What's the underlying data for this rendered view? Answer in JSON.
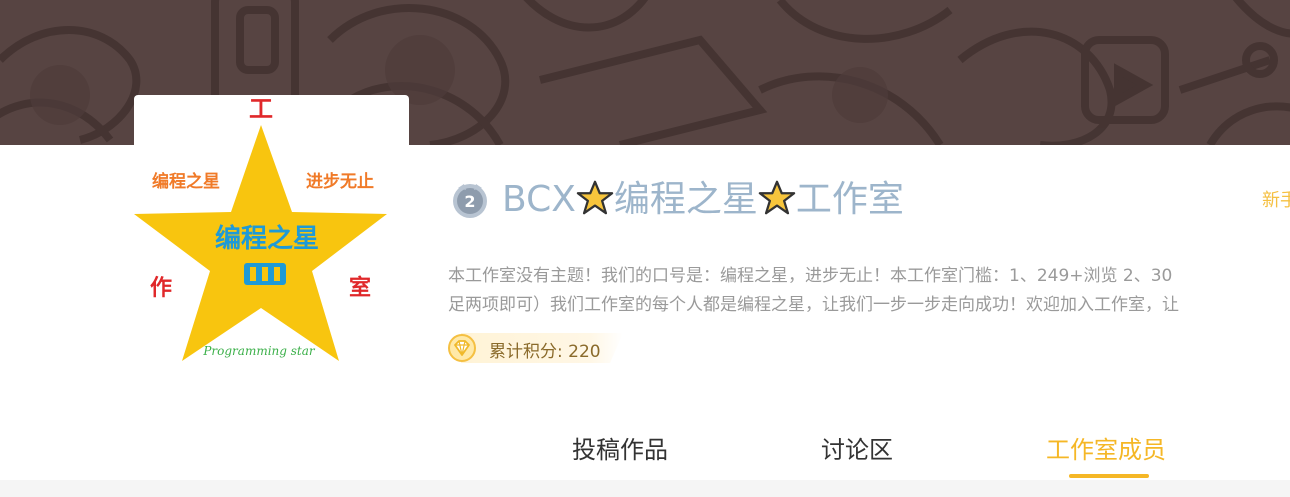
{
  "studio": {
    "name_prefix": "BCX",
    "name_mid": "编程之星",
    "name_suffix": "工作室",
    "level_number": "2",
    "newbie_label": "新手",
    "description_line1": "本工作室没有主题！我们的口号是：编程之星，进步无止！本工作室门槛：1、249+浏览 2、30",
    "description_line2": "足两项即可）我们工作室的每个人都是编程之星，让我们一步一步走向成功！欢迎加入工作室，让",
    "points_label": "累计积分: 220"
  },
  "logo": {
    "char_top": "工",
    "left_phrase": "编程之星",
    "right_phrase": "进步无止",
    "center_phrase": "编程之星",
    "char_left": "作",
    "char_right": "室",
    "english": "Programming star"
  },
  "tabs": [
    {
      "label": "投稿作品",
      "active": false
    },
    {
      "label": "讨论区",
      "active": false
    },
    {
      "label": "工作室成员",
      "active": true
    }
  ],
  "colors": {
    "banner": "#574442",
    "title": "#9db5cb",
    "accent": "#f5b726",
    "logo_star": "#f8c50f",
    "logo_red": "#e0282a",
    "logo_orange": "#f07a28",
    "logo_blue": "#1f9ad6"
  },
  "icons": {
    "level_badge": "level-2-badge-icon",
    "title_star": "star-icon",
    "points": "diamond-icon"
  }
}
